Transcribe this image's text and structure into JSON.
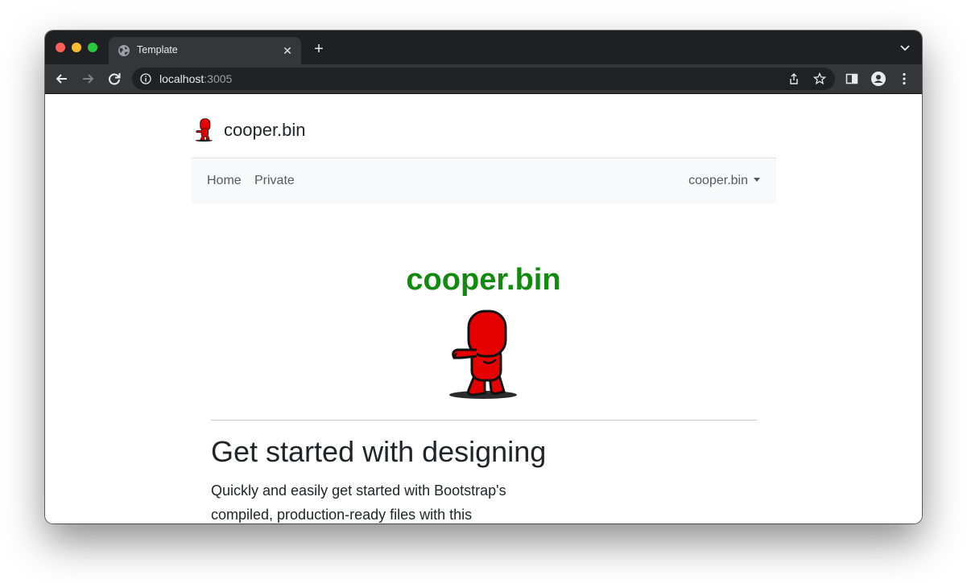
{
  "browser": {
    "tab_title": "Template",
    "url_host": "localhost",
    "url_port": ":3005"
  },
  "site": {
    "brand": "cooper.bin",
    "nav": {
      "home": "Home",
      "private": "Private",
      "user_menu": "cooper.bin"
    },
    "hero_title": "cooper.bin",
    "heading": "Get started with designing",
    "lead": "Quickly and easily get started with Bootstrap's compiled, production-ready files with this"
  },
  "colors": {
    "hero_title": "#118a0f",
    "mascot": "#e60000",
    "tab_bar": "#1f2023",
    "toolbar": "#35363a"
  },
  "icons": [
    "globe-icon",
    "close-icon",
    "plus-icon",
    "chevron-down-icon",
    "back-arrow-icon",
    "forward-arrow-icon",
    "reload-icon",
    "info-icon",
    "share-icon",
    "star-icon",
    "sidebar-icon",
    "profile-icon",
    "menu-dots-icon",
    "mascot-icon"
  ]
}
